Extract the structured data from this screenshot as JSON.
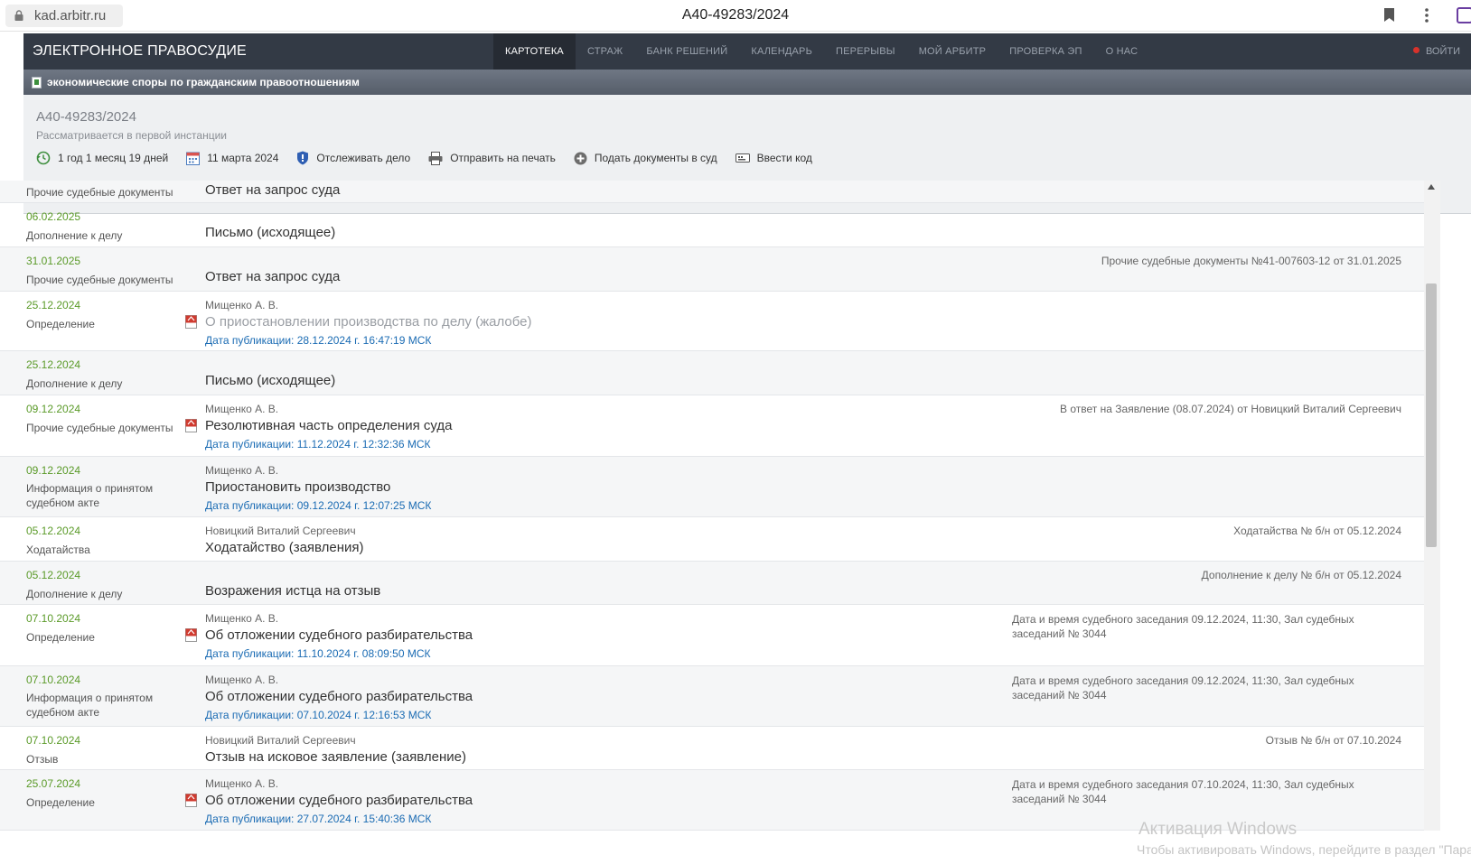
{
  "browser": {
    "url": "kad.arbitr.ru",
    "tab_title": "А40-49283/2024"
  },
  "site": {
    "brand": "ЭЛЕКТРОННОЕ ПРАВОСУДИЕ",
    "nav": [
      "КАРТОТЕКА",
      "СТРАЖ",
      "БАНК РЕШЕНИЙ",
      "КАЛЕНДАРЬ",
      "ПЕРЕРЫВЫ",
      "МОЙ АРБИТР",
      "ПРОВЕРКА ЭП",
      "О НАС"
    ],
    "nav_active": "КАРТОТЕКА",
    "login": "ВОЙТИ",
    "category": "экономические споры по гражданским правоотношениям"
  },
  "case": {
    "number": "А40-49283/2024",
    "status": "Рассматривается в первой инстанции",
    "actions": {
      "duration": "1 год 1 месяц 19 дней",
      "date": "11 марта 2024",
      "track": "Отслеживать дело",
      "print": "Отправить на печать",
      "submit": "Подать документы в суд",
      "code": "Ввести код"
    }
  },
  "rows": [
    {
      "date": "",
      "type": "Прочие судебные документы",
      "author": "",
      "title": "Ответ на запрос суда",
      "pub": "",
      "right": "",
      "pdf": false
    },
    {
      "date": "06.02.2025",
      "type": "Дополнение к делу",
      "author": "",
      "title": "Письмо (исходящее)",
      "pub": "",
      "right": "",
      "pdf": false
    },
    {
      "date": "31.01.2025",
      "type": "Прочие судебные документы",
      "author": "",
      "title": "Ответ на запрос суда",
      "pub": "",
      "right": "Прочие судебные документы №41-007603-12 от 31.01.2025",
      "pdf": false
    },
    {
      "date": "25.12.2024",
      "type": "Определение",
      "author": "Мищенко А. В.",
      "title": "О приостановлении производства по делу (жалобе)",
      "pub": "Дата публикации: 28.12.2024 г. 16:47:19 МСК",
      "right": "",
      "pdf": true
    },
    {
      "date": "25.12.2024",
      "type": "Дополнение к делу",
      "author": "",
      "title": "Письмо (исходящее)",
      "pub": "",
      "right": "",
      "pdf": false
    },
    {
      "date": "09.12.2024",
      "type": "Прочие судебные документы",
      "author": "Мищенко А. В.",
      "title": "Резолютивная часть определения суда",
      "pub": "Дата публикации: 11.12.2024 г. 12:32:36 МСК",
      "right": "В ответ на Заявление (08.07.2024) от Новицкий Виталий Сергеевич",
      "pdf": true
    },
    {
      "date": "09.12.2024",
      "type": "Информация о принятом судебном акте",
      "author": "Мищенко А. В.",
      "title": "Приостановить производство",
      "pub": "Дата публикации: 09.12.2024 г. 12:07:25 МСК",
      "right": "",
      "pdf": false
    },
    {
      "date": "05.12.2024",
      "type": "Ходатайства",
      "author": "Новицкий Виталий Сергеевич",
      "title": "Ходатайство (заявления)",
      "pub": "",
      "right": "Ходатайства № б/н от 05.12.2024",
      "pdf": false
    },
    {
      "date": "05.12.2024",
      "type": "Дополнение к делу",
      "author": "",
      "title": "Возражения истца на отзыв",
      "pub": "",
      "right": "Дополнение к делу № б/н от 05.12.2024",
      "pdf": false
    },
    {
      "date": "07.10.2024",
      "type": "Определение",
      "author": "Мищенко А. В.",
      "title": "Об отложении судебного разбирательства",
      "pub": "Дата публикации: 11.10.2024 г. 08:09:50 МСК",
      "right": "Дата и время судебного заседания 09.12.2024, 11:30, Зал судебных заседаний № 3044",
      "pdf": true
    },
    {
      "date": "07.10.2024",
      "type": "Информация о принятом судебном акте",
      "author": "Мищенко А. В.",
      "title": "Об отложении судебного разбирательства",
      "pub": "Дата публикации: 07.10.2024 г. 12:16:53 МСК",
      "right": "Дата и время судебного заседания 09.12.2024, 11:30, Зал судебных заседаний № 3044",
      "pdf": false
    },
    {
      "date": "07.10.2024",
      "type": "Отзыв",
      "author": "Новицкий Виталий Сергеевич",
      "title": "Отзыв на исковое заявление (заявление)",
      "pub": "",
      "right": "Отзыв № б/н от 07.10.2024",
      "pdf": false
    },
    {
      "date": "25.07.2024",
      "type": "Определение",
      "author": "Мищенко А. В.",
      "title": "Об отложении судебного разбирательства",
      "pub": "Дата публикации: 27.07.2024 г. 15:40:36 МСК",
      "right": "Дата и время судебного заседания 07.10.2024, 11:30, Зал судебных заседаний № 3044",
      "pdf": true
    }
  ],
  "watermark": {
    "line1": "Активация Windows",
    "line2": "Чтобы активировать Windows, перейдите в раздел \"Параметры\"."
  }
}
